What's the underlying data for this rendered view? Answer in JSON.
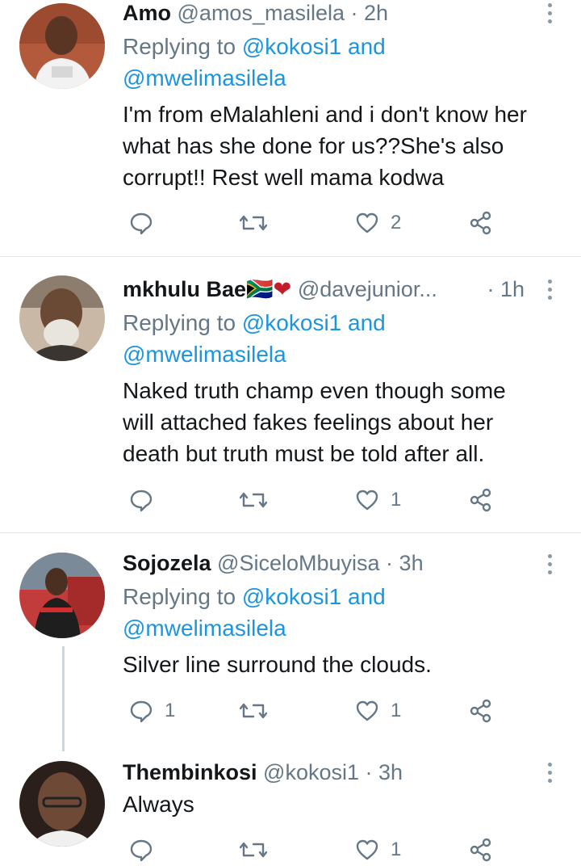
{
  "tweets": [
    {
      "name": "Amo",
      "handle": "@amos_masilela",
      "time": "2h",
      "replying_prefix": "Replying to ",
      "replying_to_1": "@kokosi1",
      "replying_and": " and",
      "replying_to_2": "@mwelimasilela",
      "text_lines": [
        "I'm from eMalahleni and i don't know her",
        "what has she done for us??She's also",
        "corrupt!!  Rest well mama kodwa"
      ],
      "replies": "",
      "retweets": "",
      "likes": "2"
    },
    {
      "name": "mkhulu Bae",
      "name_emoji": "🇿🇦❤",
      "handle": "@davejunior...",
      "time": "1h",
      "replying_prefix": "Replying to ",
      "replying_to_1": "@kokosi1",
      "replying_and": " and",
      "replying_to_2": "@mwelimasilela",
      "text_lines": [
        "Naked truth champ even though some",
        "will attached fakes feelings about her",
        "death but truth must be told after all."
      ],
      "replies": "",
      "retweets": "",
      "likes": "1"
    },
    {
      "name": "Sojozela",
      "handle": "@SiceloMbuyisa",
      "time": "3h",
      "replying_prefix": "Replying to ",
      "replying_to_1": "@kokosi1",
      "replying_and": " and",
      "replying_to_2": "@mwelimasilela",
      "text_lines": [
        "Silver line surround the clouds."
      ],
      "replies": "1",
      "retweets": "",
      "likes": "1"
    },
    {
      "name": "Thembinkosi",
      "handle": "@kokosi1",
      "time": "3h",
      "text_lines": [
        "Always"
      ],
      "replies": "",
      "retweets": "",
      "likes": "1"
    }
  ],
  "separator": " · ",
  "icons": [
    "reply-icon",
    "retweet-icon",
    "like-icon",
    "share-icon",
    "more-icon"
  ],
  "colors": {
    "link": "#1b95e0",
    "secondary": "#657786",
    "divider": "#e1e8ed",
    "text": "#14171a"
  }
}
